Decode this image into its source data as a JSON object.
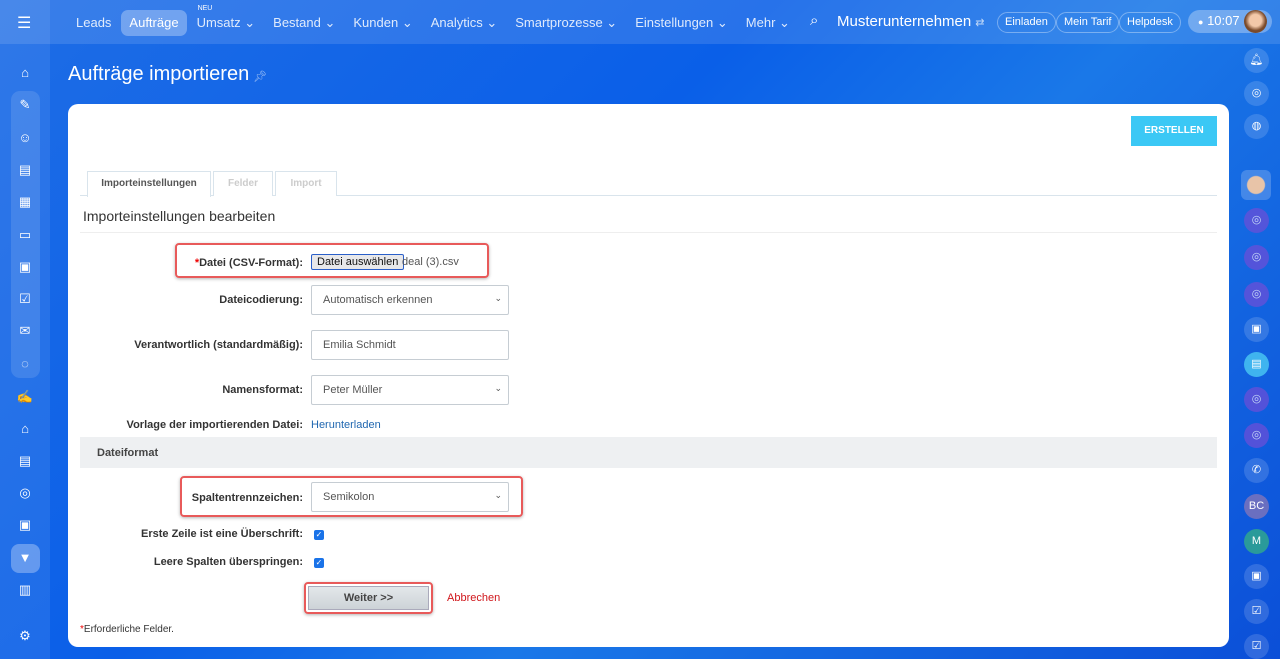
{
  "topbar": {
    "nav": [
      {
        "label": "Leads"
      },
      {
        "label": "Aufträge",
        "active": true
      },
      {
        "label": "Umsatz",
        "badge": "NEU"
      },
      {
        "label": "Bestand"
      },
      {
        "label": "Kunden"
      },
      {
        "label": "Analytics"
      },
      {
        "label": "Smartprozesse"
      },
      {
        "label": "Einstellungen"
      },
      {
        "label": "Mehr"
      }
    ],
    "company": "Musterunternehmen",
    "invite": "Einladen",
    "tariff": "Mein Tarif",
    "helpdesk": "Helpdesk",
    "time": "10:07"
  },
  "right_sidebar": {
    "initials_bc": "BC",
    "initials_m": "M"
  },
  "page": {
    "title": "Aufträge importieren",
    "create_button": "ERSTELLEN",
    "tabs": [
      "Importeinstellungen",
      "Felder",
      "Import"
    ],
    "heading": "Importeinstellungen bearbeiten",
    "form": {
      "file_label": "Datei (CSV-Format):",
      "file_required_mark": "*",
      "file_button": "Datei auswählen",
      "file_name": "deal (3).csv",
      "encoding_label": "Dateicodierung:",
      "encoding_value": "Automatisch erkennen",
      "responsible_label": "Verantwortlich (standardmäßig):",
      "responsible_value": "Emilia Schmidt",
      "nameformat_label": "Namensformat:",
      "nameformat_value": "Peter Müller",
      "template_label": "Vorlage der importierenden Datei:",
      "template_link": "Herunterladen",
      "section": "Dateiformat",
      "separator_label": "Spaltentrennzeichen:",
      "separator_value": "Semikolon",
      "header_label": "Erste Zeile ist eine Überschrift:",
      "header_checked": true,
      "skip_label": "Leere Spalten überspringen:",
      "skip_checked": true,
      "next_button": "Weiter >>",
      "cancel_link": "Abbrechen",
      "required_note": "Erforderliche Felder."
    }
  }
}
